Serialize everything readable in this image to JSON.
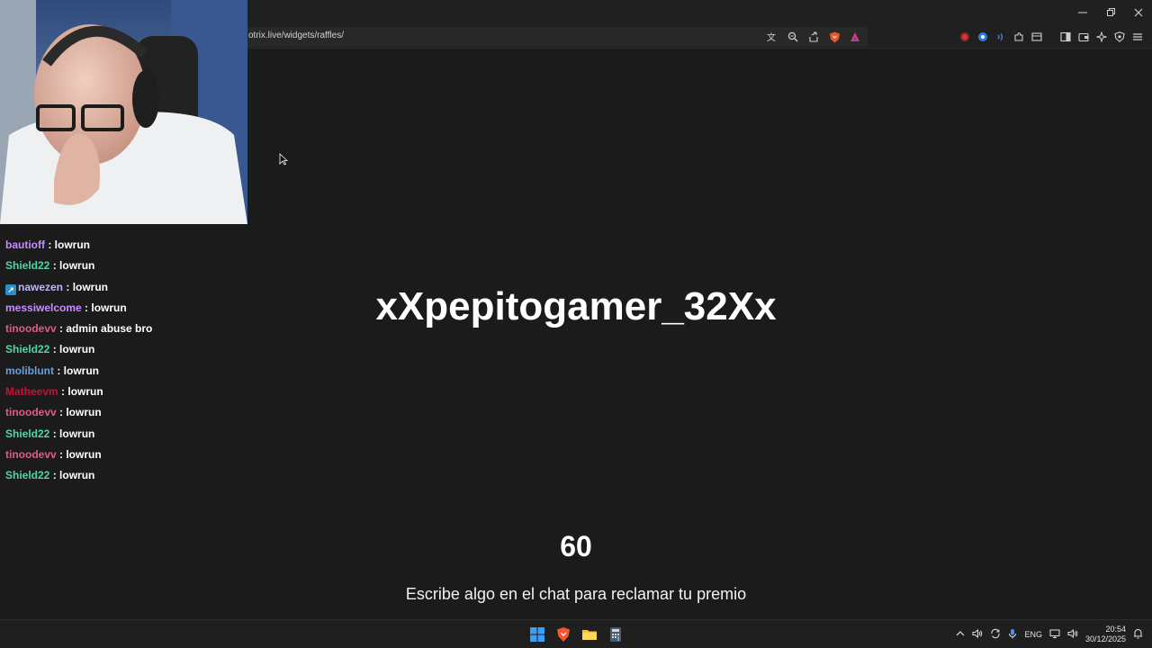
{
  "browser": {
    "url": "otrix.live/widgets/raffles/",
    "url_icons": [
      "translate-icon",
      "zoom-icon",
      "share-icon",
      "brave-shields-icon",
      "brave-rewards-icon"
    ],
    "extension_icons": [
      "record-icon",
      "extension-blue-icon",
      "sound-icon",
      "puzzle-icon",
      "tab-capture-icon"
    ],
    "right_icons": [
      "sidebar-icon",
      "wallet-icon",
      "leo-ai-icon",
      "vpn-icon",
      "menu-icon"
    ]
  },
  "chat": {
    "messages": [
      {
        "user": "bautioff",
        "separator": " : ",
        "text": "lowrun",
        "color": "#c98cff"
      },
      {
        "user": "Shield22",
        "separator": " : ",
        "text": "lowrun",
        "color": "#4fd6a5"
      },
      {
        "user": "nawezen",
        "separator": " : ",
        "text": "lowrun",
        "color": "#b9b9ff"
      },
      {
        "user": "messiwelcome",
        "separator": " : ",
        "text": "lowrun",
        "color": "#c98cff"
      },
      {
        "user": "tinoodevv",
        "separator": " : ",
        "text": "admin abuse bro",
        "color": "#e05a8a"
      },
      {
        "user": "Shield22",
        "separator": " : ",
        "text": "lowrun",
        "color": "#4fd6a5"
      },
      {
        "user": "moliblunt",
        "separator": " : ",
        "text": "lowrun",
        "color": "#6a9fe0"
      },
      {
        "user": "Matheevm",
        "separator": " : ",
        "text": "lowrun",
        "color": "#c8103c"
      },
      {
        "user": "tinoodevv",
        "separator": " : ",
        "text": "lowrun",
        "color": "#e05a8a"
      },
      {
        "user": "Shield22",
        "separator": " : ",
        "text": "lowrun",
        "color": "#4fd6a5"
      },
      {
        "user": "tinoodevv",
        "separator": " : ",
        "text": "lowrun",
        "color": "#e05a8a"
      },
      {
        "user": "Shield22",
        "separator": " : ",
        "text": "lowrun",
        "color": "#4fd6a5"
      }
    ]
  },
  "raffle": {
    "winner": "xXpepitogamer_32Xx",
    "countdown": "60",
    "instructions": "Escribe algo en el chat para reclamar tu premio"
  },
  "taskbar": {
    "apps": [
      "windows-start-icon",
      "brave-browser-icon",
      "file-explorer-icon",
      "calculator-icon"
    ],
    "language": "ENG",
    "time": "20:54",
    "date": "30/12/2025"
  },
  "colors": {
    "background": "#1b1b1b",
    "chrome": "#202020",
    "text": "#ffffff"
  }
}
